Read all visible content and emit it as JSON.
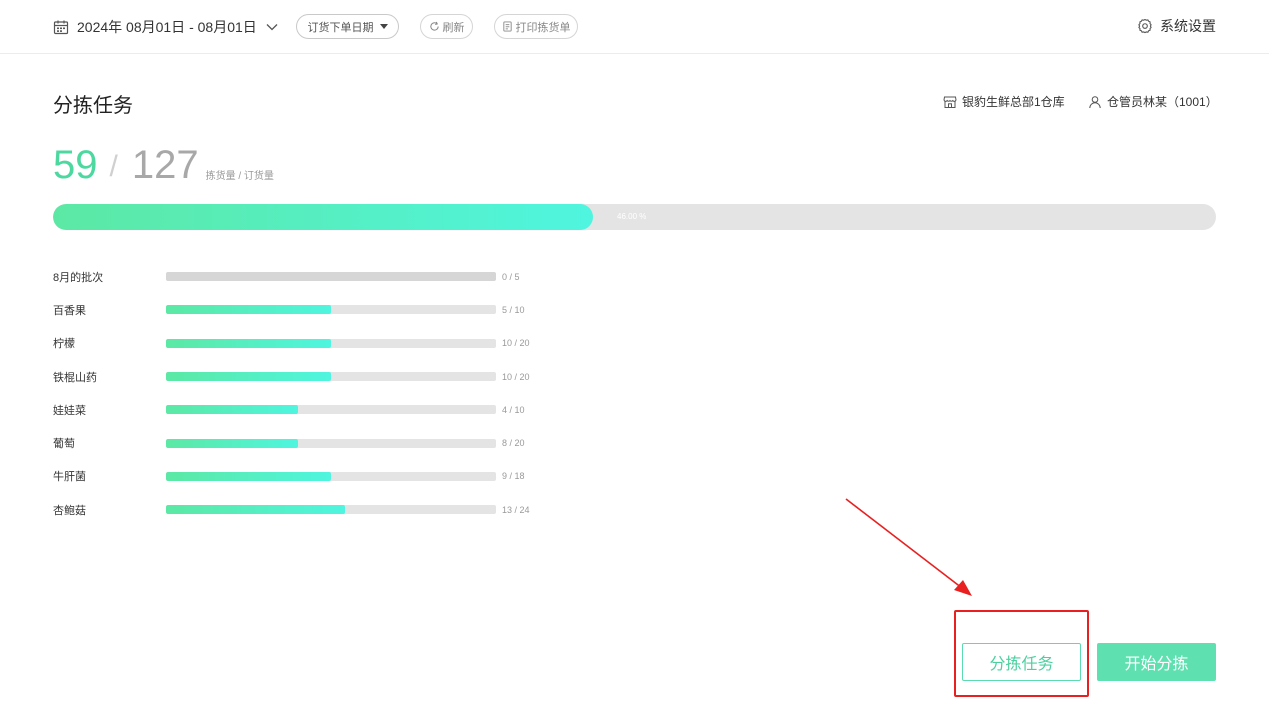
{
  "topbar": {
    "date_range": "2024年 08月01日 - 08月01日",
    "order_date_label": "订货下单日期",
    "refresh_label": "刷新",
    "print_label": "打印拣货单",
    "settings_label": "系统设置"
  },
  "header": {
    "title": "分拣任务",
    "warehouse": "银豹生鲜总部1仓库",
    "operator": "仓管员林某（1001）"
  },
  "summary": {
    "picked": "59",
    "separator": "/",
    "total": "127",
    "unit_label": "拣货量 / 订货量",
    "percent_label": "46.00 %",
    "progress": 0.4646
  },
  "items": [
    {
      "name": "8月的批次",
      "done": 0,
      "total": 5,
      "count_label": "0 / 5"
    },
    {
      "name": "百香果",
      "done": 5,
      "total": 10,
      "count_label": "5 / 10"
    },
    {
      "name": "柠檬",
      "done": 10,
      "total": 20,
      "count_label": "10 / 20"
    },
    {
      "name": "铁棍山药",
      "done": 10,
      "total": 20,
      "count_label": "10 / 20"
    },
    {
      "name": "娃娃菜",
      "done": 4,
      "total": 10,
      "count_label": "4 / 10"
    },
    {
      "name": "葡萄",
      "done": 8,
      "total": 20,
      "count_label": "8 / 20"
    },
    {
      "name": "牛肝菌",
      "done": 9,
      "total": 18,
      "count_label": "9 / 18"
    },
    {
      "name": "杏鲍菇",
      "done": 13,
      "total": 24,
      "count_label": "13 / 24"
    }
  ],
  "actions": {
    "tasks_label": "分拣任务",
    "start_label": "开始分拣"
  },
  "colors": {
    "accent": "#4dd8a0",
    "accent_end": "#4ff5df",
    "annotation": "#e82020"
  }
}
